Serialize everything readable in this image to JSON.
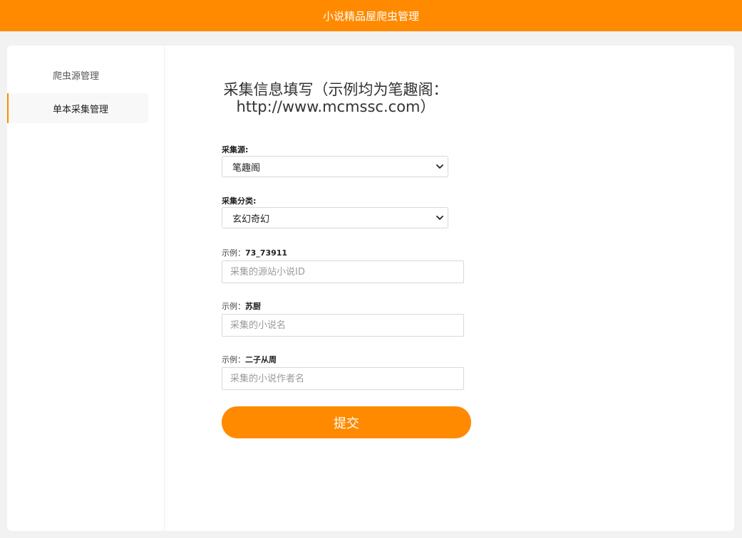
{
  "header": {
    "title": "小说精品屋爬虫管理"
  },
  "sidebar": {
    "items": [
      {
        "label": "爬虫源管理"
      },
      {
        "label": "单本采集管理"
      }
    ]
  },
  "form": {
    "title_line1": "采集信息填写（示例均为笔趣阁：",
    "title_line2": "http://www.mcmssc.com）",
    "source": {
      "label": "采集源:",
      "value": "笔趣阁"
    },
    "category": {
      "label": "采集分类:",
      "value": "玄幻奇幻"
    },
    "novel_id": {
      "label_prefix": "示例：",
      "label_example": "73_73911",
      "placeholder": "采集的源站小说ID"
    },
    "novel_name": {
      "label_prefix": "示例：",
      "label_example": "苏厨",
      "placeholder": "采集的小说名"
    },
    "author_name": {
      "label_prefix": "示例：",
      "label_example": "二子从周",
      "placeholder": "采集的小说作者名"
    },
    "submit_label": "提交"
  },
  "colors": {
    "accent": "#ff8a00",
    "background": "#f2f2f2"
  },
  "icons": {
    "select_arrow": "chevron-down-icon"
  }
}
